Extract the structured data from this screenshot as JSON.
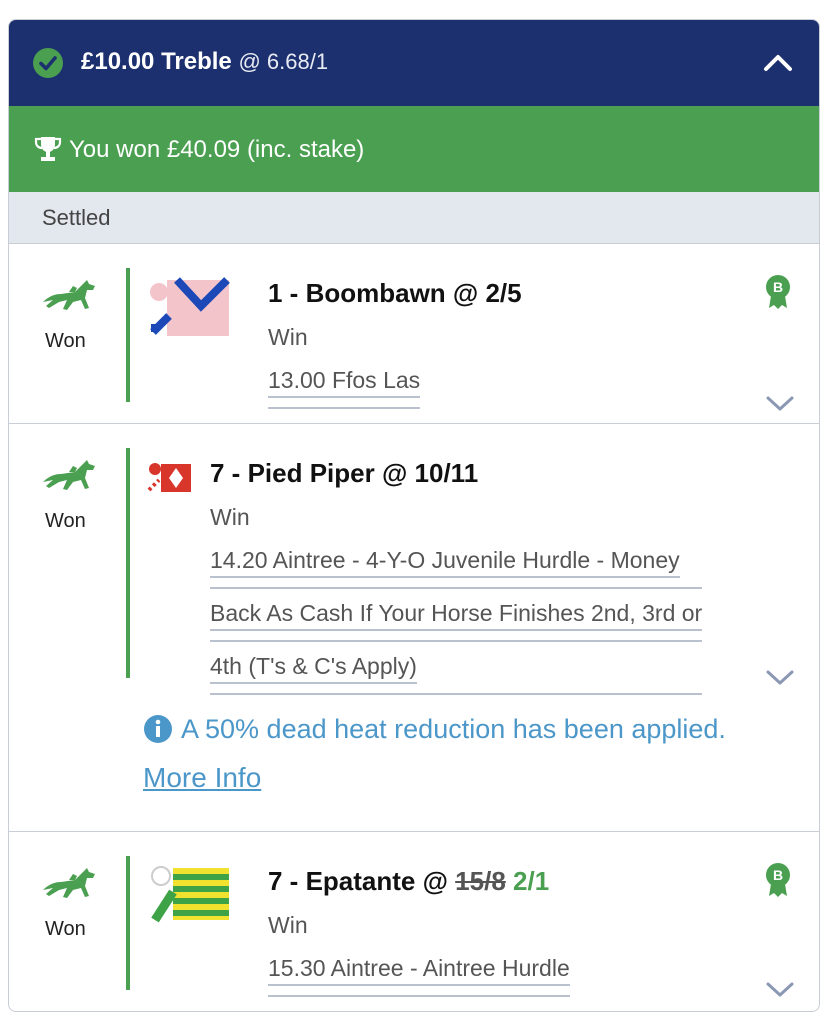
{
  "header": {
    "stake": "£10.00 Treble",
    "odds": "@ 6.68/1",
    "check_icon": "check-circle-icon",
    "toggle_icon": "chevron-up-icon"
  },
  "result": {
    "text": "You won £40.09 (inc. stake)",
    "icon": "trophy-icon"
  },
  "section": {
    "label": "Settled"
  },
  "legs": [
    {
      "status": "Won",
      "selection": "1 - Boombawn @ 2/5",
      "market": "Win",
      "event_lines": [
        "13.00 Ffos Las"
      ],
      "boost": "B"
    },
    {
      "status": "Won",
      "selection": "7 - Pied Piper @ 10/11",
      "market": "Win",
      "event_lines": [
        "14.20 Aintree - 4-Y-O Juvenile Hurdle - Money",
        "Back As Cash If Your Horse Finishes 2nd, 3rd or",
        "4th (T's & C's Apply)"
      ],
      "info_text": "A 50% dead heat reduction has been applied.",
      "info_link": "More Info"
    },
    {
      "status": "Won",
      "selection_prefix": "7 - Epatante @ ",
      "old_odds": "15/8",
      "new_odds": "2/1",
      "market": "Win",
      "event_lines": [
        "15.30 Aintree - Aintree Hurdle"
      ],
      "boost": "B"
    }
  ],
  "colors": {
    "navy": "#1c2f6e",
    "green": "#4a9f50",
    "info_blue": "#4c97c9",
    "light_grey": "#e3e7ee"
  }
}
